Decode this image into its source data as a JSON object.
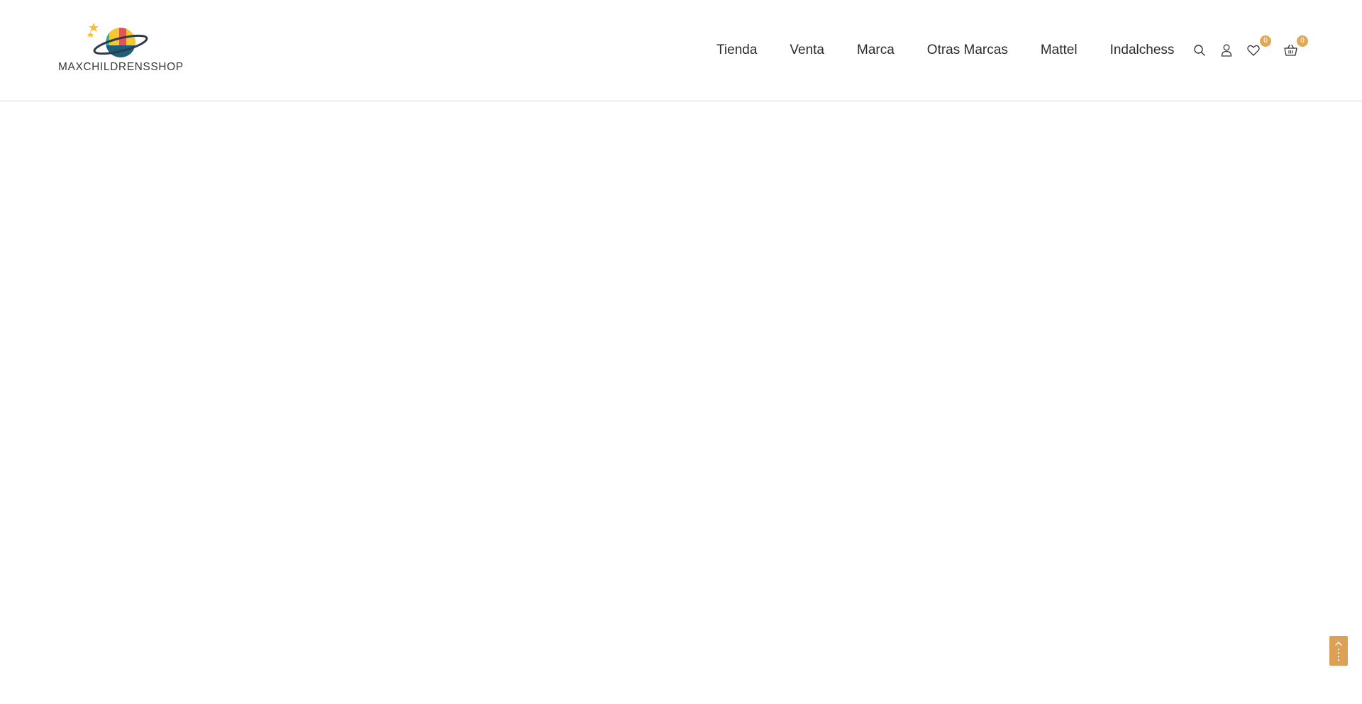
{
  "brand": {
    "name": "MAXCHILDRENSSHOP",
    "accent_color": "#e0a95a"
  },
  "nav": {
    "items": [
      {
        "label": "Tienda"
      },
      {
        "label": "Venta"
      },
      {
        "label": "Marca"
      },
      {
        "label": "Otras Marcas"
      },
      {
        "label": "Mattel"
      },
      {
        "label": "Indalchess"
      }
    ]
  },
  "header_icons": {
    "search": {
      "icon": "search-icon"
    },
    "account": {
      "icon": "user-icon"
    },
    "wishlist": {
      "icon": "heart-icon",
      "count": "0"
    },
    "cart": {
      "icon": "basket-icon",
      "count": "0"
    }
  },
  "page": {
    "state": "loading"
  },
  "back_to_top": {
    "icon": "arrow-up-icon"
  }
}
